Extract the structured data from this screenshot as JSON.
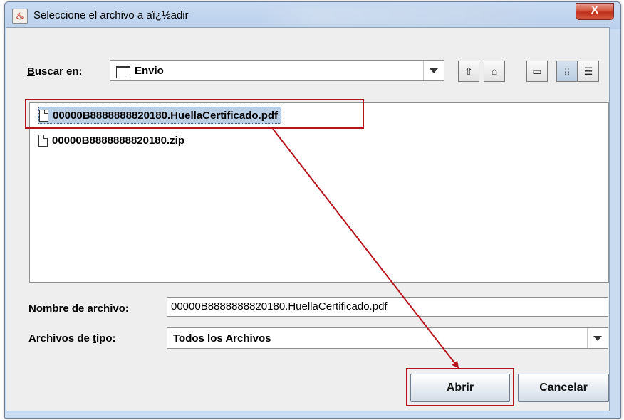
{
  "window": {
    "title": "Seleccione el archivo a aï¿½adir",
    "title_icon": "java-cup-icon",
    "close_label": "X"
  },
  "lookin": {
    "label": "Buscar en:",
    "mnemonic": "B",
    "rest": "uscar en:",
    "value": "Envio"
  },
  "toolbar": {
    "buttons": [
      {
        "name": "up-one-level-icon",
        "glyph": "⇧"
      },
      {
        "name": "home-icon",
        "glyph": "⌂"
      },
      {
        "name": "new-folder-icon",
        "glyph": "▭"
      },
      {
        "name": "list-view-icon",
        "glyph": "⁞⁞"
      },
      {
        "name": "details-view-icon",
        "glyph": "☰"
      }
    ]
  },
  "files": [
    {
      "name": "00000B8888888820180.HuellaCertificado.pdf",
      "selected": true
    },
    {
      "name": "00000B8888888820180.zip",
      "selected": false
    }
  ],
  "filename": {
    "label_mnemonic": "N",
    "label_rest": "ombre de archivo:",
    "value": "00000B8888888820180.HuellaCertificado.pdf"
  },
  "filetype": {
    "label_pre": "Archivos de ",
    "label_mnemonic": "t",
    "label_post": "ipo:",
    "value": "Todos los Archivos"
  },
  "buttons": {
    "open": "Abrir",
    "cancel": "Cancelar"
  },
  "colors": {
    "annotation": "#b8121b",
    "selection": "#b9cfe6"
  }
}
